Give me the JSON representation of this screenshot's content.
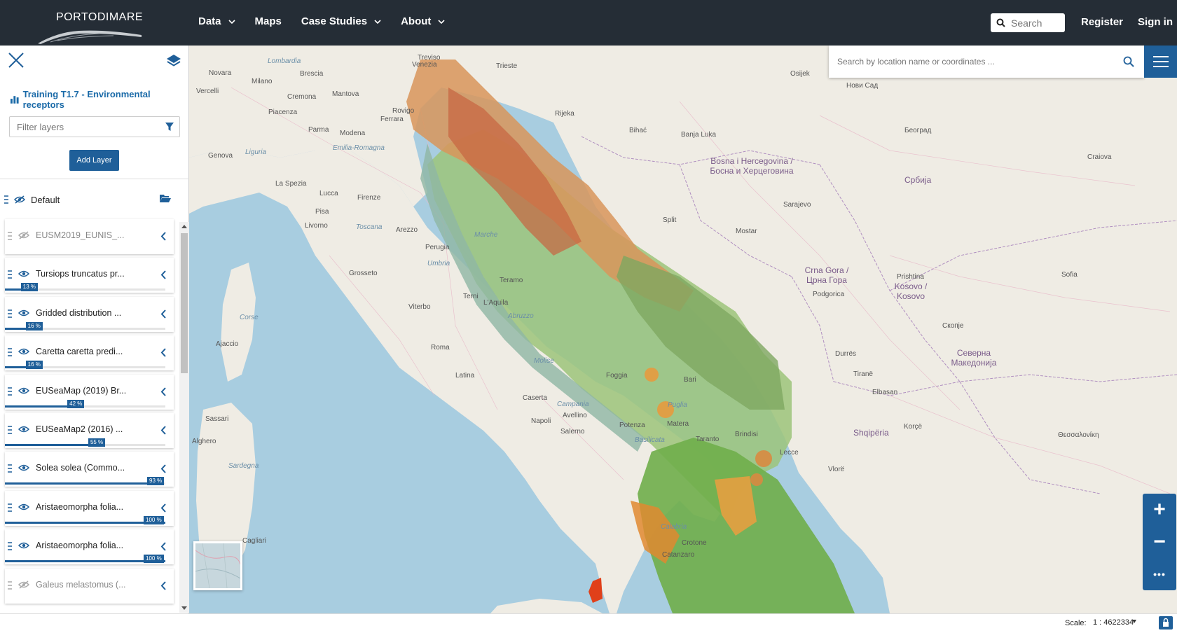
{
  "header": {
    "logo_text": "PORTODIMARE",
    "nav": [
      {
        "label": "Data",
        "has_dropdown": true
      },
      {
        "label": "Maps",
        "has_dropdown": false
      },
      {
        "label": "Case Studies",
        "has_dropdown": true
      },
      {
        "label": "About",
        "has_dropdown": true
      }
    ],
    "search_placeholder": "Search",
    "register": "Register",
    "sign_in": "Sign in"
  },
  "sidebar": {
    "title": "Training T1.7 - Environmental receptors",
    "filter_placeholder": "Filter layers",
    "add_layer": "Add Layer",
    "group": {
      "label": "Default",
      "visible": false
    },
    "layers": [
      {
        "label": "EUSM2019_EUNIS_...",
        "visible": false,
        "opacity": null,
        "opacity_label": ""
      },
      {
        "label": "Tursiops truncatus pr...",
        "visible": true,
        "opacity": 13,
        "opacity_label": "13 %"
      },
      {
        "label": "Gridded distribution ...",
        "visible": true,
        "opacity": 16,
        "opacity_label": "16 %"
      },
      {
        "label": "Caretta caretta predi...",
        "visible": true,
        "opacity": 16,
        "opacity_label": "16 %"
      },
      {
        "label": "EUSeaMap (2019) Br...",
        "visible": true,
        "opacity": 42,
        "opacity_label": "42 %"
      },
      {
        "label": "EUSeaMap2 (2016) ...",
        "visible": true,
        "opacity": 55,
        "opacity_label": "55 %"
      },
      {
        "label": "Solea solea (Commo...",
        "visible": true,
        "opacity": 93,
        "opacity_label": "93 %"
      },
      {
        "label": "Aristaeomorpha folia...",
        "visible": true,
        "opacity": 100,
        "opacity_label": "100 %"
      },
      {
        "label": "Aristaeomorpha folia...",
        "visible": true,
        "opacity": 100,
        "opacity_label": "100 %"
      },
      {
        "label": "Galeus melastomus (...",
        "visible": false,
        "opacity": null,
        "opacity_label": ""
      }
    ]
  },
  "map": {
    "location_search_placeholder": "Search by location name or coordinates ...",
    "labels": [
      {
        "text": "Venezia",
        "type": "city"
      },
      {
        "text": "Trieste",
        "type": "city"
      },
      {
        "text": "Milano",
        "type": "city"
      },
      {
        "text": "Brescia",
        "type": "city"
      },
      {
        "text": "Novara",
        "type": "city"
      },
      {
        "text": "Vercelli",
        "type": "city"
      },
      {
        "text": "Lombardia",
        "type": "region"
      },
      {
        "text": "Cremona",
        "type": "city"
      },
      {
        "text": "Mantova",
        "type": "city"
      },
      {
        "text": "Treviso",
        "type": "city"
      },
      {
        "text": "Piacenza",
        "type": "city"
      },
      {
        "text": "Parma",
        "type": "city"
      },
      {
        "text": "Modena",
        "type": "city"
      },
      {
        "text": "Ferrara",
        "type": "city"
      },
      {
        "text": "Rovigo",
        "type": "city"
      },
      {
        "text": "Genova",
        "type": "city"
      },
      {
        "text": "Liguria",
        "type": "region"
      },
      {
        "text": "Emilia-Romagna",
        "type": "region"
      },
      {
        "text": "La Spezia",
        "type": "city"
      },
      {
        "text": "Lucca",
        "type": "city"
      },
      {
        "text": "Pisa",
        "type": "city"
      },
      {
        "text": "Firenze",
        "type": "city"
      },
      {
        "text": "Livorno",
        "type": "city"
      },
      {
        "text": "Toscana",
        "type": "region"
      },
      {
        "text": "Arezzo",
        "type": "city"
      },
      {
        "text": "Perugia",
        "type": "city"
      },
      {
        "text": "Umbria",
        "type": "region"
      },
      {
        "text": "Marche",
        "type": "region"
      },
      {
        "text": "Grosseto",
        "type": "city"
      },
      {
        "text": "Corse",
        "type": "region"
      },
      {
        "text": "Ajaccio",
        "type": "city"
      },
      {
        "text": "Terni",
        "type": "city"
      },
      {
        "text": "Viterbo",
        "type": "city"
      },
      {
        "text": "L'Aquila",
        "type": "city"
      },
      {
        "text": "Abruzzo",
        "type": "region"
      },
      {
        "text": "Teramo",
        "type": "city"
      },
      {
        "text": "Roma",
        "type": "city"
      },
      {
        "text": "Latina",
        "type": "city"
      },
      {
        "text": "Molise",
        "type": "region"
      },
      {
        "text": "Foggia",
        "type": "city"
      },
      {
        "text": "Caserta",
        "type": "city"
      },
      {
        "text": "Napoli",
        "type": "city"
      },
      {
        "text": "Campania",
        "type": "region"
      },
      {
        "text": "Avellino",
        "type": "city"
      },
      {
        "text": "Salerno",
        "type": "city"
      },
      {
        "text": "Potenza",
        "type": "city"
      },
      {
        "text": "Basilicata",
        "type": "region"
      },
      {
        "text": "Puglia",
        "type": "region"
      },
      {
        "text": "Matera",
        "type": "city"
      },
      {
        "text": "Bari",
        "type": "city"
      },
      {
        "text": "Taranto",
        "type": "city"
      },
      {
        "text": "Brindisi",
        "type": "city"
      },
      {
        "text": "Lecce",
        "type": "city"
      },
      {
        "text": "Calabria",
        "type": "region"
      },
      {
        "text": "Crotone",
        "type": "city"
      },
      {
        "text": "Catanzaro",
        "type": "city"
      },
      {
        "text": "Sassari",
        "type": "city"
      },
      {
        "text": "Sardegna",
        "type": "region"
      },
      {
        "text": "Cagliari",
        "type": "city"
      },
      {
        "text": "Alghero",
        "type": "city"
      },
      {
        "text": "Rijeka",
        "type": "city"
      },
      {
        "text": "Split",
        "type": "city"
      },
      {
        "text": "Bihać",
        "type": "city"
      },
      {
        "text": "Banja Luka",
        "type": "city"
      },
      {
        "text": "Sarajevo",
        "type": "city"
      },
      {
        "text": "Mostar",
        "type": "city"
      },
      {
        "text": "Bosna i Hercegovina / Босна и Херцеговина",
        "type": "country"
      },
      {
        "text": "Crna Gora / Црна Гора",
        "type": "country"
      },
      {
        "text": "Podgorica",
        "type": "city"
      },
      {
        "text": "Србија",
        "type": "country"
      },
      {
        "text": "Београд",
        "type": "city"
      },
      {
        "text": "Нови Сад",
        "type": "city"
      },
      {
        "text": "Kosovo / Kosovo",
        "type": "country"
      },
      {
        "text": "Prishtina",
        "type": "city"
      },
      {
        "text": "Shqipëria",
        "type": "country"
      },
      {
        "text": "Tiranë",
        "type": "city"
      },
      {
        "text": "Северна Македонија",
        "type": "country"
      },
      {
        "text": "Скопје",
        "type": "city"
      },
      {
        "text": "Sofia",
        "type": "city"
      },
      {
        "text": "Θεσσαλονίκη",
        "type": "city"
      },
      {
        "text": "Craiova",
        "type": "city"
      },
      {
        "text": "Osijek",
        "type": "city"
      },
      {
        "text": "Durrës",
        "type": "city"
      },
      {
        "text": "Elbasan",
        "type": "city"
      },
      {
        "text": "Vlorë",
        "type": "city"
      },
      {
        "text": "Korçë",
        "type": "city"
      }
    ],
    "zoom_in": "+",
    "zoom_out": "−",
    "more": "•••"
  },
  "footer": {
    "scale_label": "Scale:",
    "scale_value": "1 : 4622334"
  },
  "colors": {
    "header_bg": "#252d36",
    "accent": "#1f5f99",
    "sea": "#a8cde0",
    "land": "#efece4"
  }
}
